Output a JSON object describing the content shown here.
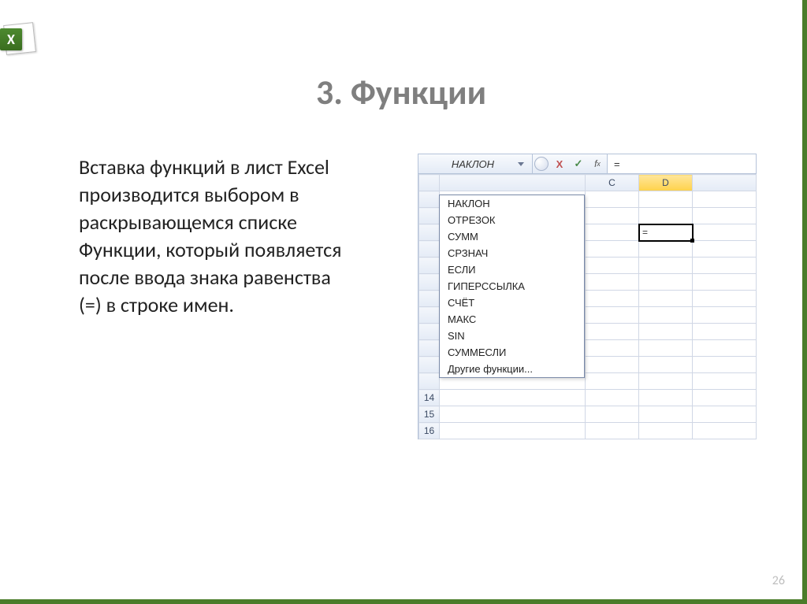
{
  "title": "3. Функции",
  "body": "Вставка функций в лист Excel производится выбором в раскрывающемся списке Функции, который появляется после ввода знака равенства (=) в строке имен.",
  "page_number": "26",
  "excel": {
    "namebox_value": "НАКЛОН",
    "formula_value": "=",
    "columns": [
      "C",
      "D"
    ],
    "selected_column": "D",
    "active_cell_value": "=",
    "visible_row_headers": [
      "14",
      "15",
      "16"
    ],
    "function_list": [
      "НАКЛОН",
      "ОТРЕЗОК",
      "СУММ",
      "СРЗНАЧ",
      "ЕСЛИ",
      "ГИПЕРССЫЛКА",
      "СЧЁТ",
      "МАКС",
      "SIN",
      "СУММЕСЛИ",
      "Другие функции..."
    ]
  }
}
